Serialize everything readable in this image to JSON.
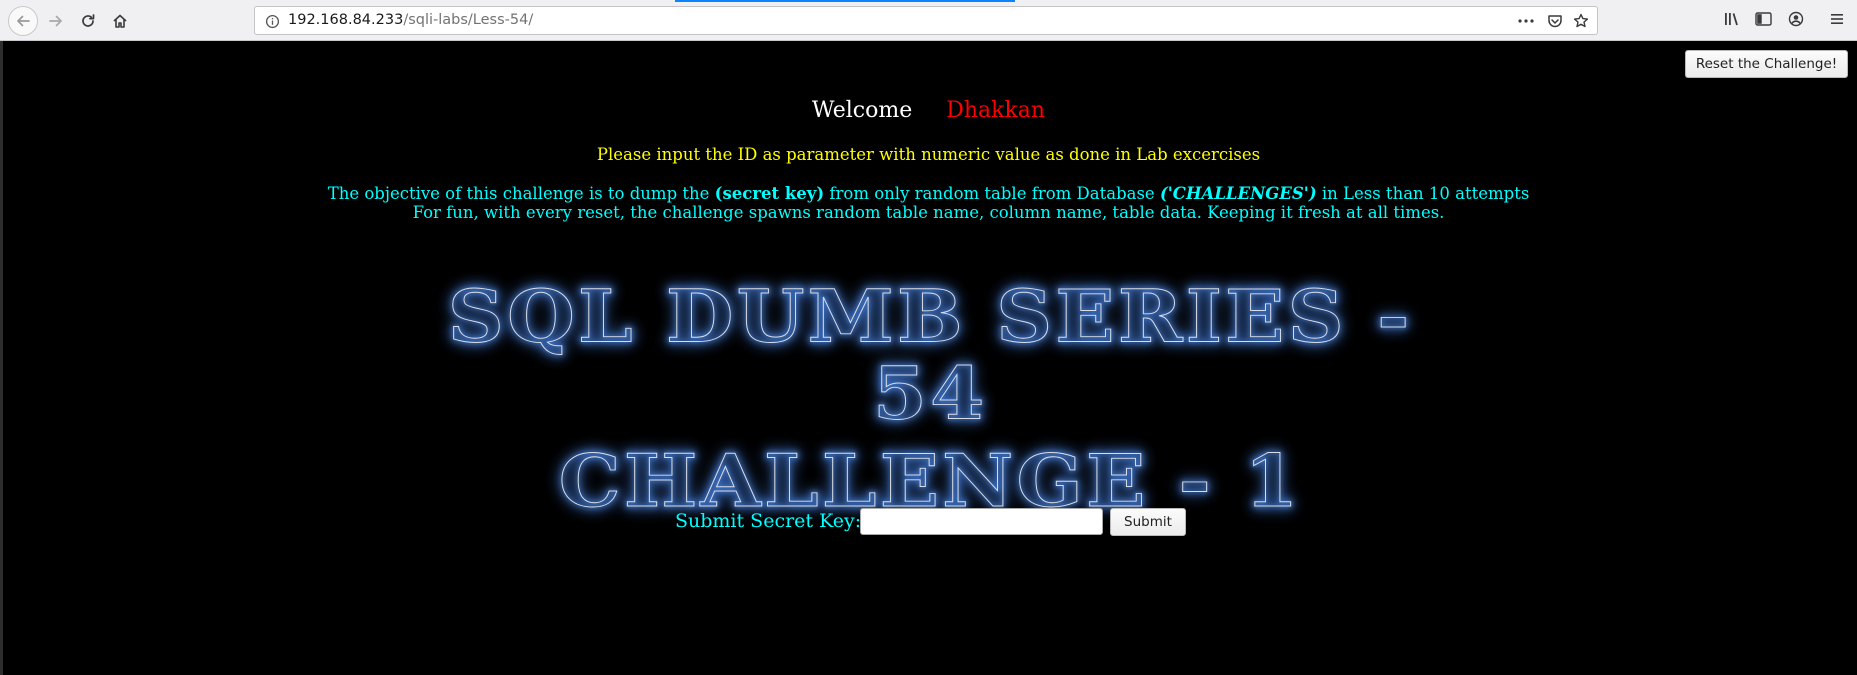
{
  "browser": {
    "url_host": "192.168.84.233",
    "url_path": "/sqli-labs/Less-54/"
  },
  "page": {
    "reset_button_label": "Reset the Challenge!",
    "welcome_label": "Welcome",
    "welcome_user": "Dhakkan",
    "instruction": "Please input the ID as parameter with numeric value as done in Lab excercises",
    "objective": {
      "part1": "The objective of this challenge is to dump the ",
      "secret_key": "(secret key)",
      "part2": " from only random table from Database ",
      "database": "('CHALLENGES')",
      "part3": " in Less than 10 attempts"
    },
    "fun_note": "For fun, with every reset, the challenge spawns random table name, column name, table data. Keeping it fresh at all times.",
    "banner_line1": "SQL DUMB SERIES - 54",
    "banner_line2": "CHALLENGE - 1",
    "submit_label": "Submit Secret Key:",
    "secret_key_value": "",
    "submit_button_label": "Submit"
  },
  "colors": {
    "background": "#000000",
    "welcome_user": "#ff0000",
    "instruction": "#ffff00",
    "objective": "#00ffff",
    "banner_glow": "#1d5fe0"
  },
  "icons": [
    "back-arrow-icon",
    "forward-arrow-icon",
    "reload-icon",
    "home-icon",
    "info-icon",
    "more-dots-icon",
    "pocket-icon",
    "bookmark-star-icon",
    "library-icon",
    "sidebar-icon",
    "account-icon",
    "menu-icon"
  ]
}
